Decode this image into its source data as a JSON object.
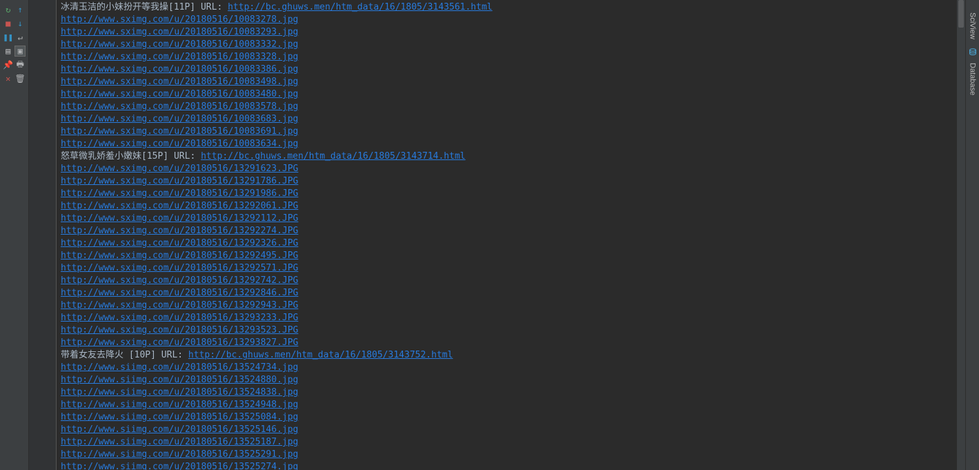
{
  "right_tabs": [
    {
      "label": "SciView"
    },
    {
      "label": "Database"
    }
  ],
  "entries": [
    {
      "type": "title",
      "text": "冰清玉洁的小妹扮开等我操[11P] URL: ",
      "url": "http://bc.ghuws.men/htm_data/16/1805/3143561.html"
    },
    {
      "type": "link",
      "url": "http://www.sximg.com/u/20180516/10083278.jpg"
    },
    {
      "type": "link",
      "url": "http://www.sximg.com/u/20180516/10083293.jpg"
    },
    {
      "type": "link",
      "url": "http://www.sximg.com/u/20180516/10083332.jpg"
    },
    {
      "type": "link",
      "url": "http://www.sximg.com/u/20180516/10083328.jpg"
    },
    {
      "type": "link",
      "url": "http://www.sximg.com/u/20180516/10083386.jpg"
    },
    {
      "type": "link",
      "url": "http://www.sximg.com/u/20180516/10083498.jpg"
    },
    {
      "type": "link",
      "url": "http://www.sximg.com/u/20180516/10083480.jpg"
    },
    {
      "type": "link",
      "url": "http://www.sximg.com/u/20180516/10083578.jpg"
    },
    {
      "type": "link",
      "url": "http://www.sximg.com/u/20180516/10083683.jpg"
    },
    {
      "type": "link",
      "url": "http://www.sximg.com/u/20180516/10083691.jpg"
    },
    {
      "type": "link",
      "url": "http://www.sximg.com/u/20180516/10083634.jpg"
    },
    {
      "type": "title",
      "text": "怒草微乳娇羞小嫩妹[15P] URL: ",
      "url": "http://bc.ghuws.men/htm_data/16/1805/3143714.html"
    },
    {
      "type": "link",
      "url": "http://www.sximg.com/u/20180516/13291623.JPG"
    },
    {
      "type": "link",
      "url": "http://www.sximg.com/u/20180516/13291786.JPG"
    },
    {
      "type": "link",
      "url": "http://www.sximg.com/u/20180516/13291986.JPG"
    },
    {
      "type": "link",
      "url": "http://www.sximg.com/u/20180516/13292061.JPG"
    },
    {
      "type": "link",
      "url": "http://www.sximg.com/u/20180516/13292112.JPG"
    },
    {
      "type": "link",
      "url": "http://www.sximg.com/u/20180516/13292274.JPG"
    },
    {
      "type": "link",
      "url": "http://www.sximg.com/u/20180516/13292326.JPG"
    },
    {
      "type": "link",
      "url": "http://www.sximg.com/u/20180516/13292495.JPG"
    },
    {
      "type": "link",
      "url": "http://www.sximg.com/u/20180516/13292571.JPG"
    },
    {
      "type": "link",
      "url": "http://www.sximg.com/u/20180516/13292742.JPG"
    },
    {
      "type": "link",
      "url": "http://www.sximg.com/u/20180516/13292846.JPG"
    },
    {
      "type": "link",
      "url": "http://www.sximg.com/u/20180516/13292943.JPG"
    },
    {
      "type": "link",
      "url": "http://www.sximg.com/u/20180516/13293233.JPG"
    },
    {
      "type": "link",
      "url": "http://www.sximg.com/u/20180516/13293523.JPG"
    },
    {
      "type": "link",
      "url": "http://www.sximg.com/u/20180516/13293827.JPG"
    },
    {
      "type": "title",
      "text": "带着女友去降火 [10P] URL: ",
      "url": "http://bc.ghuws.men/htm_data/16/1805/3143752.html"
    },
    {
      "type": "link",
      "url": "http://www.siimg.com/u/20180516/13524734.jpg"
    },
    {
      "type": "link",
      "url": "http://www.siimg.com/u/20180516/13524880.jpg"
    },
    {
      "type": "link",
      "url": "http://www.siimg.com/u/20180516/13524838.jpg"
    },
    {
      "type": "link",
      "url": "http://www.siimg.com/u/20180516/13524948.jpg"
    },
    {
      "type": "link",
      "url": "http://www.siimg.com/u/20180516/13525084.jpg"
    },
    {
      "type": "link",
      "url": "http://www.siimg.com/u/20180516/13525146.jpg"
    },
    {
      "type": "link",
      "url": "http://www.siimg.com/u/20180516/13525187.jpg"
    },
    {
      "type": "link",
      "url": "http://www.siimg.com/u/20180516/13525291.jpg"
    },
    {
      "type": "link",
      "url": "http://www.siimg.com/u/20180516/13525274.jpg"
    }
  ]
}
